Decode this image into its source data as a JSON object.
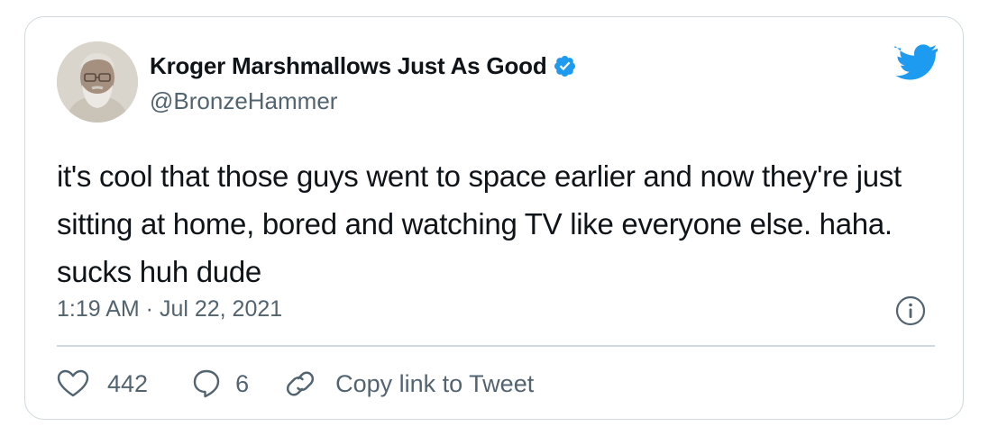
{
  "author": {
    "display_name": "Kroger Marshmallows Just As Good",
    "handle": "@BronzeHammer",
    "verified": true,
    "avatar_icon": "avatar-photo"
  },
  "tweet": {
    "text": "it's cool that those guys went to space earlier and now they're just sitting at home, bored and watching TV like everyone else. haha. sucks huh dude",
    "timestamp": "1:19 AM · Jul 22, 2021"
  },
  "actions": {
    "likes_count": "442",
    "replies_count": "6",
    "copy_link_label": "Copy link to Tweet"
  },
  "icons": {
    "brand": "twitter-bird-icon",
    "verified": "verified-badge-icon",
    "info": "info-icon",
    "like": "heart-icon",
    "reply": "speech-bubble-icon",
    "copy": "link-icon"
  },
  "colors": {
    "brand_blue": "#1d9bf0",
    "text_primary": "#0f1419",
    "text_secondary": "#536471",
    "border": "#cfd9de"
  }
}
